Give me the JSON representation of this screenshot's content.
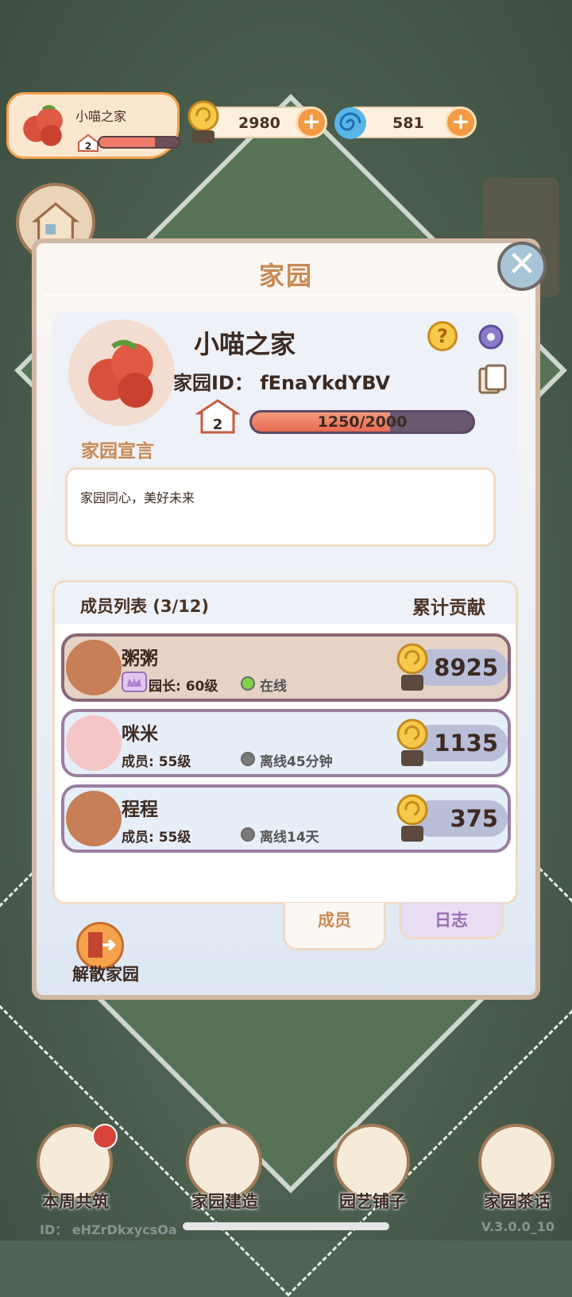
{
  "hud": {
    "home_name": "小喵之家",
    "home_level": "2",
    "home_exp_ratio": 0.7,
    "coins": "2980",
    "gems": "581"
  },
  "modal": {
    "title": "家园",
    "home_name": "小喵之家",
    "home_id": "家园ID：  fEnaYkdYBV",
    "level": "2",
    "exp_text": "1250/2000",
    "exp_ratio": 0.625,
    "manifesto_label": "家园宣言",
    "manifesto_text": "家园同心，美好未来",
    "member_list_title": "成员列表 (3/12)",
    "contribution_title": "累计贡献",
    "members": [
      {
        "name": "粥粥",
        "role": "园长: 60级",
        "status": "在线",
        "score": "8925",
        "online": true
      },
      {
        "name": "咪米",
        "role": "成员: 55级",
        "status": "离线45分钟",
        "score": "1135",
        "online": false
      },
      {
        "name": "程程",
        "role": "成员: 55级",
        "status": "离线14天",
        "score": "375",
        "online": false
      }
    ],
    "tabs": {
      "members": "成员",
      "log": "日志"
    },
    "disband_label": "解散家园"
  },
  "nav": {
    "weekly": "本周共筑",
    "build": "家园建造",
    "shop": "园艺铺子",
    "chat": "家园茶话"
  },
  "footer": {
    "id": "ID：  eHZrDkxycsOa",
    "version": "V.3.0.0_10"
  },
  "colors": {
    "accent": "#c98a53",
    "online": "#7ed34a",
    "offline": "#6a6a6a",
    "plus_button": "#f29a44"
  }
}
